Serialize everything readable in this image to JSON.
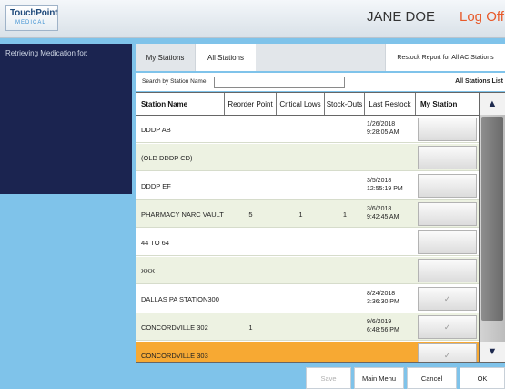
{
  "app": {
    "logo_main": "TouchPoint",
    "logo_sub": "MEDICAL",
    "user_name": "JANE DOE",
    "logoff_label": "Log Off"
  },
  "sidebar": {
    "retrieving_label": "Retrieving Medication for:"
  },
  "tabs": {
    "my_stations": "My Stations",
    "all_stations": "All Stations",
    "restock_report": "Restock Report for All AC Stations"
  },
  "search": {
    "label": "Search by Station Name",
    "value": "",
    "list_title": "All Stations List"
  },
  "table": {
    "headers": {
      "name": "Station Name",
      "reorder": "Reorder Point",
      "critical": "Critical Lows",
      "stockouts": "Stock-Outs",
      "last_restock": "Last Restock",
      "my_station": "My Station"
    },
    "rows": [
      {
        "name": "DDDP AB",
        "reorder": "",
        "critical": "",
        "stockouts": "",
        "date": "1/26/2018",
        "time": "9:28:05 AM",
        "check": ""
      },
      {
        "name": "(OLD DDDP CD)",
        "reorder": "",
        "critical": "",
        "stockouts": "",
        "date": "",
        "time": "",
        "check": ""
      },
      {
        "name": "DDDP EF",
        "reorder": "",
        "critical": "",
        "stockouts": "",
        "date": "3/5/2018",
        "time": "12:55:19 PM",
        "check": ""
      },
      {
        "name": "PHARMACY NARC VAULT",
        "reorder": "5",
        "critical": "1",
        "stockouts": "1",
        "date": "3/6/2018",
        "time": "9:42:45 AM",
        "check": ""
      },
      {
        "name": "44 TO 64",
        "reorder": "",
        "critical": "",
        "stockouts": "",
        "date": "",
        "time": "",
        "check": ""
      },
      {
        "name": "XXX",
        "reorder": "",
        "critical": "",
        "stockouts": "",
        "date": "",
        "time": "",
        "check": ""
      },
      {
        "name": "DALLAS PA STATION300",
        "reorder": "",
        "critical": "",
        "stockouts": "",
        "date": "8/24/2018",
        "time": "3:36:30 PM",
        "check": "✓"
      },
      {
        "name": "CONCORDVILLE 302",
        "reorder": "1",
        "critical": "",
        "stockouts": "",
        "date": "9/6/2019",
        "time": "6:48:56 PM",
        "check": "✓"
      },
      {
        "name": "CONCORDVILLE 303",
        "reorder": "",
        "critical": "",
        "stockouts": "",
        "date": "",
        "time": "",
        "check": "✓"
      }
    ],
    "selected_row": 8
  },
  "footer": {
    "save": "Save",
    "main_menu": "Main Menu",
    "cancel": "Cancel",
    "ok": "OK"
  },
  "colors": {
    "background": "#7fc3ea",
    "sidebar": "#1b2450",
    "row_alt": "#edf2e2",
    "selected_row": "#f7a933",
    "logoff": "#e85a2a"
  },
  "icons": {
    "scroll_up": "double-chevron-up-icon",
    "scroll_down": "double-chevron-down-icon",
    "check": "check-icon"
  }
}
